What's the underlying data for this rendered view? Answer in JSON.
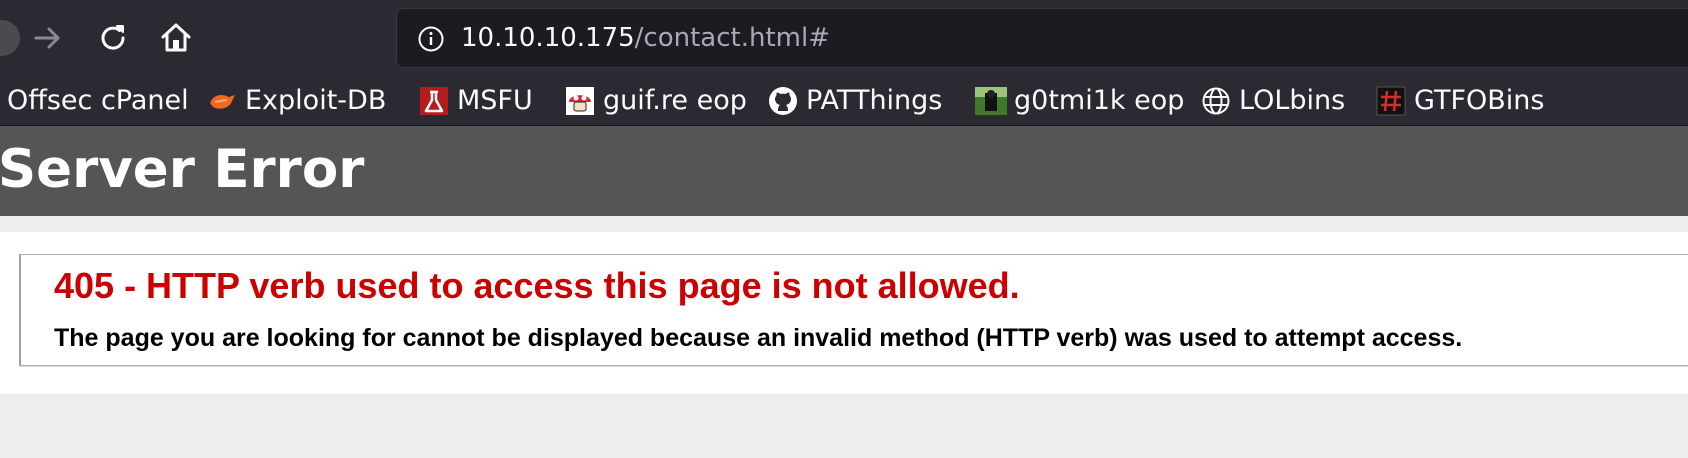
{
  "browser": {
    "url": {
      "host": "10.10.10.175",
      "path": "/contact.html#"
    },
    "bookmarks": [
      {
        "label": "Offsec cPanel",
        "icon": "offsec-icon"
      },
      {
        "label": "Exploit-DB",
        "icon": "exploit-db-icon"
      },
      {
        "label": "MSFU",
        "icon": "msfu-icon"
      },
      {
        "label": "guif.re eop",
        "icon": "guifre-mushroom-icon"
      },
      {
        "label": "PATThings",
        "icon": "github-icon"
      },
      {
        "label": "g0tmi1k eop",
        "icon": "g0tmi1k-thumbnail-icon"
      },
      {
        "label": "LOLbins",
        "icon": "globe-icon"
      },
      {
        "label": "GTFOBins",
        "icon": "gtfobins-icon"
      }
    ]
  },
  "page": {
    "title": "Server Error",
    "error_heading": "405 - HTTP verb used to access this page is not allowed.",
    "error_description": "The page you are looking for cannot be displayed because an invalid method (HTTP verb) was used to attempt access."
  },
  "colors": {
    "toolbar_bg": "#2b2a33",
    "header_bg": "#555555",
    "error_red": "#cc0000"
  }
}
